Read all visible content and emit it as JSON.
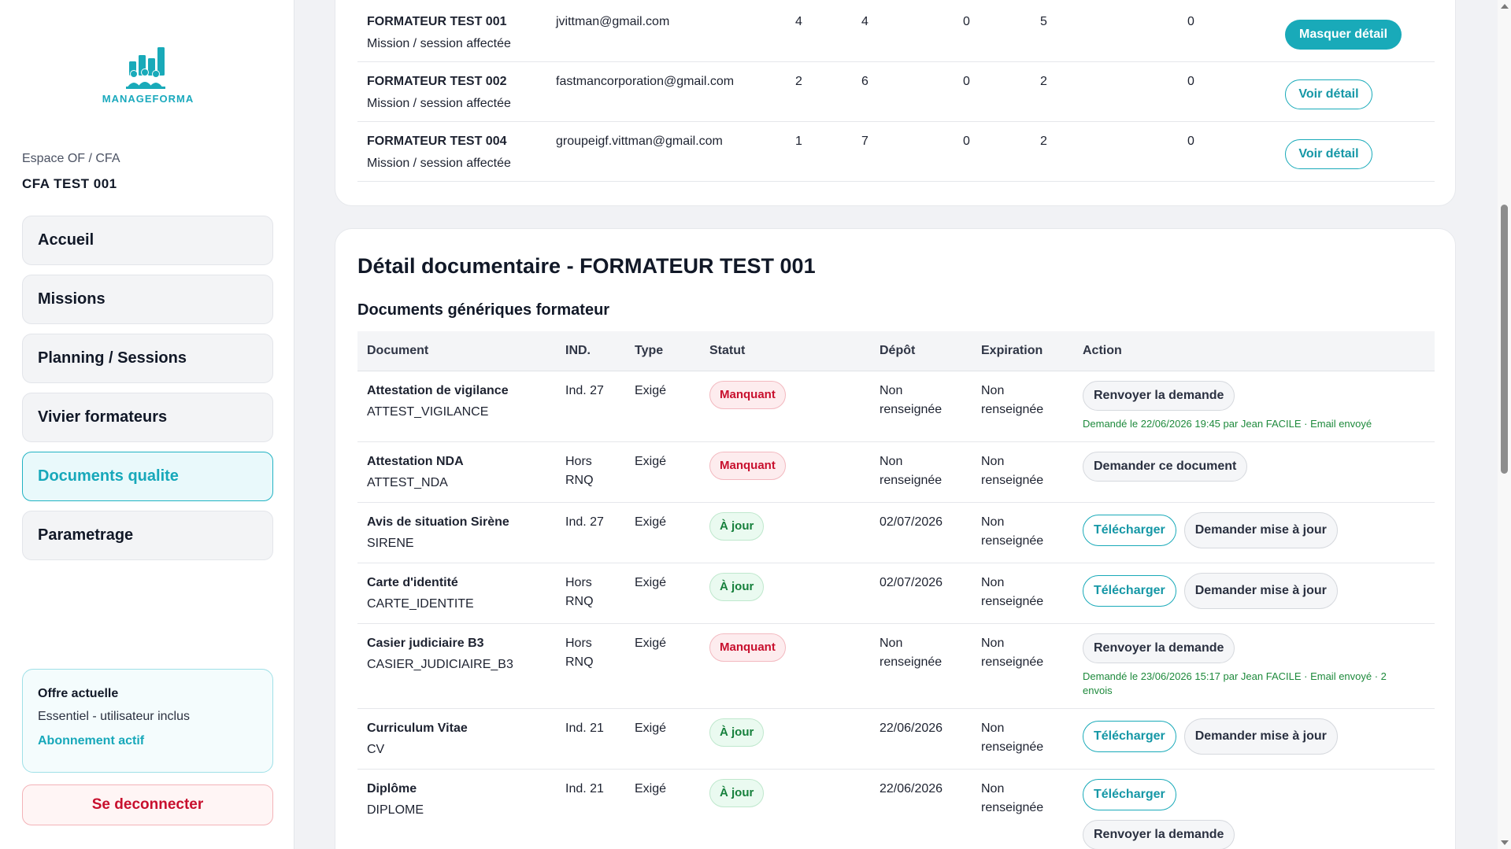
{
  "brand": {
    "name": "MANAGEFORMA",
    "accent": "#19aab9"
  },
  "sidebar": {
    "space_label": "Espace OF / CFA",
    "org_name": "CFA TEST 001",
    "nav": [
      {
        "label": "Accueil"
      },
      {
        "label": "Missions"
      },
      {
        "label": "Planning / Sessions"
      },
      {
        "label": "Vivier formateurs"
      },
      {
        "label": "Documents qualite",
        "active": true
      },
      {
        "label": "Parametrage"
      }
    ],
    "offer": {
      "title": "Offre actuelle",
      "plan": "Essentiel - utilisateur inclus",
      "status": "Abonnement actif"
    },
    "logout": "Se deconnecter"
  },
  "trainers": [
    {
      "name": "FORMATEUR TEST 001",
      "sub": "Mission / session affectée",
      "email": "jvittman@gmail.com",
      "v1": "4",
      "v2": "4",
      "v3": "0",
      "v4": "5",
      "v5": "0",
      "action": "Masquer détail"
    },
    {
      "name": "FORMATEUR TEST 002",
      "sub": "Mission / session affectée",
      "email": "fastmancorporation@gmail.com",
      "v1": "2",
      "v2": "6",
      "v3": "0",
      "v4": "2",
      "v5": "0",
      "action": "Voir détail"
    },
    {
      "name": "FORMATEUR TEST 004",
      "sub": "Mission / session affectée",
      "email": "groupeigf.vittman@gmail.com",
      "v1": "1",
      "v2": "7",
      "v3": "0",
      "v4": "2",
      "v5": "0",
      "action": "Voir détail"
    }
  ],
  "detail": {
    "title": "Détail documentaire - FORMATEUR TEST 001",
    "section": "Documents génériques formateur",
    "columns": {
      "document": "Document",
      "ind": "IND.",
      "type": "Type",
      "status": "Statut",
      "deposit": "Dépôt",
      "expiration": "Expiration",
      "action": "Action"
    },
    "rows": [
      {
        "name": "Attestation de vigilance",
        "code": "ATTEST_VIGILANCE",
        "ind": "Ind. 27",
        "type": "Exigé",
        "status": "Manquant",
        "deposit": "Non renseignée",
        "expiration": "Non renseignée",
        "actions": [
          "Renvoyer la demande"
        ],
        "note": "Demandé le 22/06/2026 19:45 par Jean FACILE · Email envoyé"
      },
      {
        "name": "Attestation NDA",
        "code": "ATTEST_NDA",
        "ind": "Hors RNQ",
        "type": "Exigé",
        "status": "Manquant",
        "deposit": "Non renseignée",
        "expiration": "Non renseignée",
        "actions": [
          "Demander ce document"
        ],
        "note": ""
      },
      {
        "name": "Avis de situation Sirène",
        "code": "SIRENE",
        "ind": "Ind. 27",
        "type": "Exigé",
        "status": "À jour",
        "deposit": "02/07/2026",
        "expiration": "Non renseignée",
        "actions": [
          "Télécharger",
          "Demander mise à jour"
        ],
        "note": ""
      },
      {
        "name": "Carte d'identité",
        "code": "CARTE_IDENTITE",
        "ind": "Hors RNQ",
        "type": "Exigé",
        "status": "À jour",
        "deposit": "02/07/2026",
        "expiration": "Non renseignée",
        "actions": [
          "Télécharger",
          "Demander mise à jour"
        ],
        "note": ""
      },
      {
        "name": "Casier judiciaire B3",
        "code": "CASIER_JUDICIAIRE_B3",
        "ind": "Hors RNQ",
        "type": "Exigé",
        "status": "Manquant",
        "deposit": "Non renseignée",
        "expiration": "Non renseignée",
        "actions": [
          "Renvoyer la demande"
        ],
        "note": "Demandé le 23/06/2026 15:17 par Jean FACILE · Email envoyé · 2 envois"
      },
      {
        "name": "Curriculum Vitae",
        "code": "CV",
        "ind": "Ind. 21",
        "type": "Exigé",
        "status": "À jour",
        "deposit": "22/06/2026",
        "expiration": "Non renseignée",
        "actions": [
          "Télécharger",
          "Demander mise à jour"
        ],
        "note": ""
      },
      {
        "name": "Diplôme",
        "code": "DIPLOME",
        "ind": "Ind. 21",
        "type": "Exigé",
        "status": "À jour",
        "deposit": "22/06/2026",
        "expiration": "Non renseignée",
        "actions": [
          "Télécharger",
          "Renvoyer la demande"
        ],
        "note": ""
      }
    ]
  }
}
